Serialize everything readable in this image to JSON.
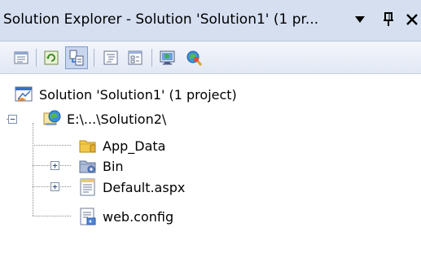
{
  "window": {
    "title": "Solution Explorer - Solution 'Solution1' (1 pr...",
    "dropdown_glyph": "▼",
    "pin_glyph": "ᵖ",
    "close_glyph": "×"
  },
  "toolbar": {
    "buttons": [
      {
        "name": "properties-icon",
        "pressed": false
      },
      {
        "name": "refresh-icon",
        "pressed": false
      },
      {
        "name": "nest-related-files-icon",
        "pressed": true
      },
      {
        "name": "view-code-icon",
        "pressed": false
      },
      {
        "name": "view-designer-icon",
        "pressed": false
      },
      {
        "name": "copy-website-icon",
        "pressed": false
      },
      {
        "name": "asp-net-configuration-icon",
        "pressed": false
      }
    ]
  },
  "tree": {
    "solution": {
      "label": "Solution 'Solution1' (1 project)",
      "icon": "solution-icon"
    },
    "project": {
      "label": "E:\\...\\Solution2\\",
      "icon": "website-icon",
      "expander": "−"
    },
    "items": [
      {
        "label": "App_Data",
        "icon": "folder-icon",
        "expander": ""
      },
      {
        "label": "Bin",
        "icon": "bin-folder-icon",
        "expander": "+"
      },
      {
        "label": "Default.aspx",
        "icon": "aspx-file-icon",
        "expander": "+"
      },
      {
        "label": "web.config",
        "icon": "config-file-icon",
        "expander": ""
      }
    ]
  },
  "colors": {
    "titlebar_bg": "#d6dff0",
    "toolbar_bg": "#e2e8f4",
    "folder_yellow": "#f2c84b",
    "accent_blue": "#2f66c8"
  }
}
